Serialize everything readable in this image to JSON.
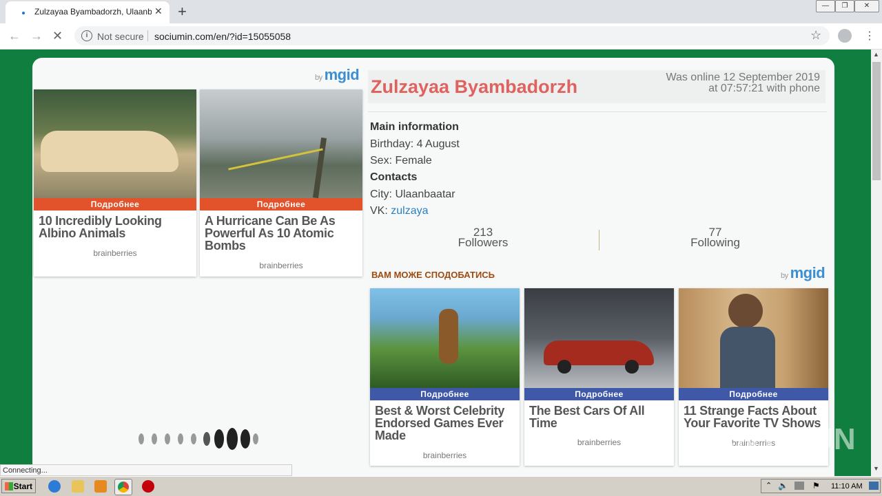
{
  "browser": {
    "tab_title": "Zulzayaa Byambadorzh, Ulaanbaatar",
    "not_secure": "Not secure",
    "url": "sociumin.com/en/?id=15055058",
    "status": "Connecting..."
  },
  "ads_left": {
    "by": "by",
    "brand": "mgid",
    "items": [
      {
        "button": "Подробнее",
        "title": "10 Incredibly Looking Albino Animals",
        "source": "brainberries"
      },
      {
        "button": "Подробнее",
        "title": "A Hurricane Can Be As Powerful As 10 Atomic Bombs",
        "source": "brainberries"
      }
    ]
  },
  "profile": {
    "name": "Zulzayaa Byambadorzh",
    "online_line1": "Was online 12 September 2019",
    "online_line2": "at 07:57:21 with phone",
    "main_heading": "Main information",
    "birthday": "Birthday: 4 August",
    "sex": "Sex: Female",
    "contacts_heading": "Contacts",
    "city": "City: Ulaanbaatar",
    "vk_label": "VK: ",
    "vk_value": "zulzaya",
    "followers_count": "213",
    "followers_label": "Followers",
    "following_count": "77",
    "following_label": "Following"
  },
  "recommend": {
    "heading": "ВАМ МОЖЕ СПОДОБАТИСЬ",
    "by": "by",
    "brand": "mgid",
    "items": [
      {
        "button": "Подробнее",
        "title": "Best & Worst Celebrity Endorsed Games Ever Made",
        "source": "brainberries"
      },
      {
        "button": "Подробнее",
        "title": "The Best Cars Of All Time",
        "source": "brainberries"
      },
      {
        "button": "Подробнее",
        "title": "11 Strange Facts About Your Favorite TV Shows",
        "source": "brainberries"
      }
    ]
  },
  "watermark": "ANY RUN",
  "taskbar": {
    "start": "Start",
    "time": "11:10 AM"
  },
  "colors": {
    "page_bg": "#0f7e3e",
    "name": "#e0625f",
    "left_ad_bar": "#e2532c",
    "reco_ad_bar": "#3f58a8",
    "link": "#2a7fc1"
  }
}
